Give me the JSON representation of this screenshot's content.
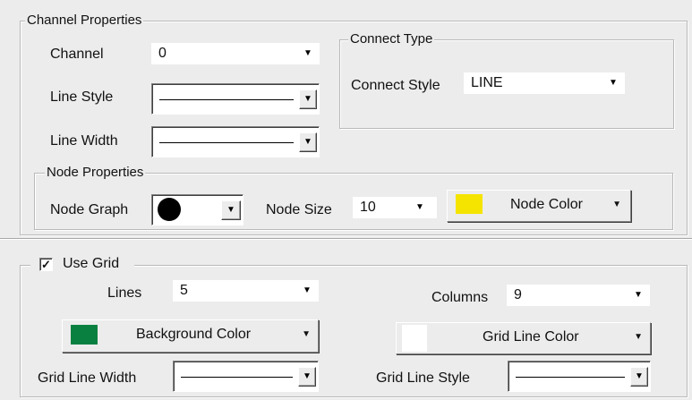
{
  "channel_properties": {
    "title": "Channel Properties",
    "channel_label": "Channel",
    "channel_value": "0",
    "line_style_label": "Line Style",
    "line_width_label": "Line Width"
  },
  "connect_type": {
    "title": "Connect Type",
    "connect_style_label": "Connect Style",
    "connect_style_value": "LINE"
  },
  "node_properties": {
    "title": "Node Properties",
    "node_graph_label": "Node Graph",
    "node_graph_value": "filled-circle",
    "node_size_label": "Node Size",
    "node_size_value": "10",
    "node_color_label": "Node Color",
    "node_color": "#f5e400"
  },
  "grid": {
    "use_grid_label": "Use Grid",
    "use_grid_checked": true,
    "lines_label": "Lines",
    "lines_value": "5",
    "columns_label": "Columns",
    "columns_value": "9",
    "background_color_label": "Background Color",
    "background_color": "#0a8040",
    "grid_line_color_label": "Grid Line Color",
    "grid_line_color": "#ffffff",
    "grid_line_width_label": "Grid Line Width",
    "grid_line_style_label": "Grid Line Style"
  }
}
